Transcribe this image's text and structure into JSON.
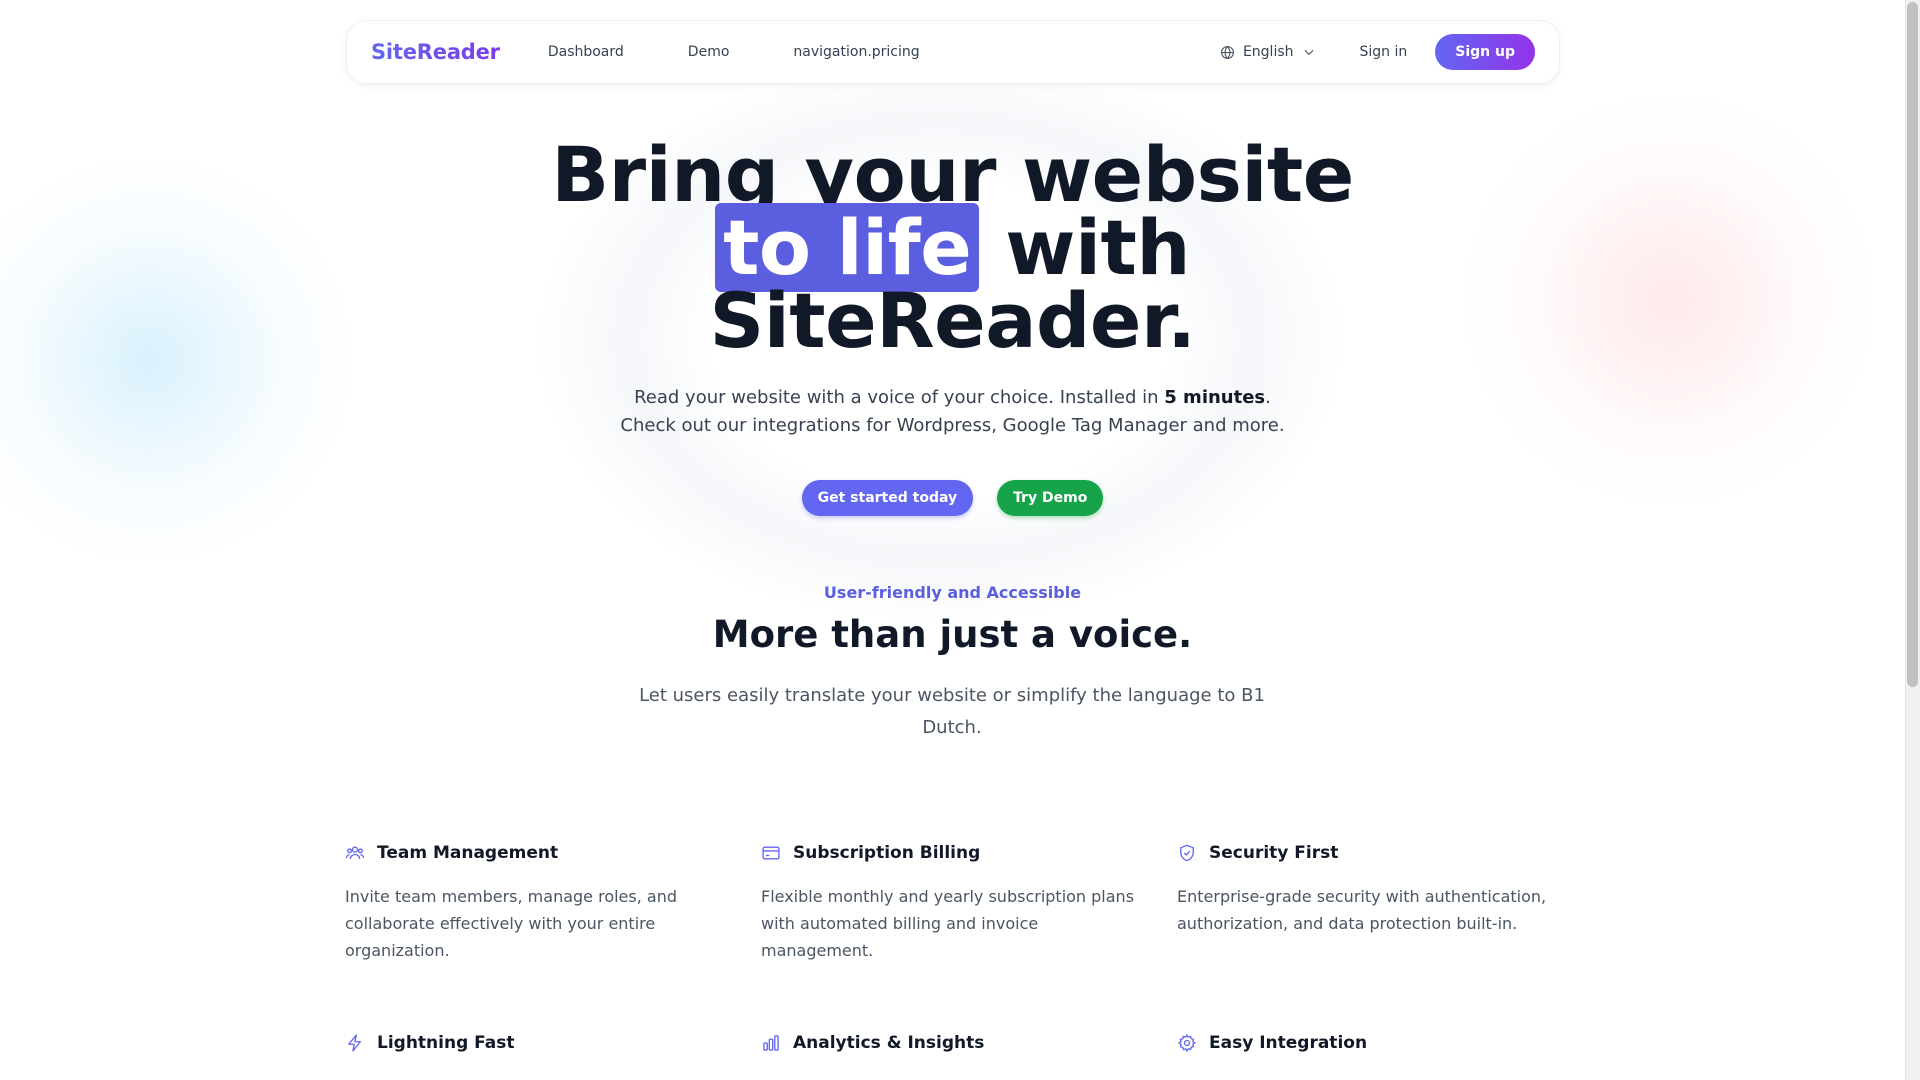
{
  "nav": {
    "brand": "SiteReader",
    "links": [
      "Dashboard",
      "Demo",
      "navigation.pricing"
    ],
    "language": "English",
    "signin": "Sign in",
    "signup": "Sign up"
  },
  "hero": {
    "title_line1": "Bring your website",
    "title_highlight": "to life",
    "title_line2_rest": " with",
    "title_line3": "SiteReader.",
    "subtitle_pre": "Read your website with a voice of your choice. Installed in ",
    "subtitle_bold": "5 minutes",
    "subtitle_post": ". Check out our integrations for Wordpress, Google Tag Manager and more.",
    "cta_primary": "Get started today",
    "cta_demo": "Try Demo"
  },
  "section": {
    "eyebrow": "User-friendly and Accessible",
    "title": "More than just a voice.",
    "subtitle": "Let users easily translate your website or simplify the language to B1 Dutch."
  },
  "features": [
    {
      "icon": "users-icon",
      "title": "Team Management",
      "description": "Invite team members, manage roles, and collaborate effectively with your entire organization."
    },
    {
      "icon": "credit-card-icon",
      "title": "Subscription Billing",
      "description": "Flexible monthly and yearly subscription plans with automated billing and invoice management."
    },
    {
      "icon": "shield-check-icon",
      "title": "Security First",
      "description": "Enterprise-grade security with authentication, authorization, and data protection built-in."
    },
    {
      "icon": "lightning-icon",
      "title": "Lightning Fast",
      "description": ""
    },
    {
      "icon": "bar-chart-icon",
      "title": "Analytics & Insights",
      "description": ""
    },
    {
      "icon": "gear-icon",
      "title": "Easy Integration",
      "description": ""
    }
  ],
  "colors": {
    "brand": "#6366f1",
    "highlight": "#5b5fdf",
    "demo": "#16a34a",
    "signup_gradient_end": "#9333ea"
  }
}
